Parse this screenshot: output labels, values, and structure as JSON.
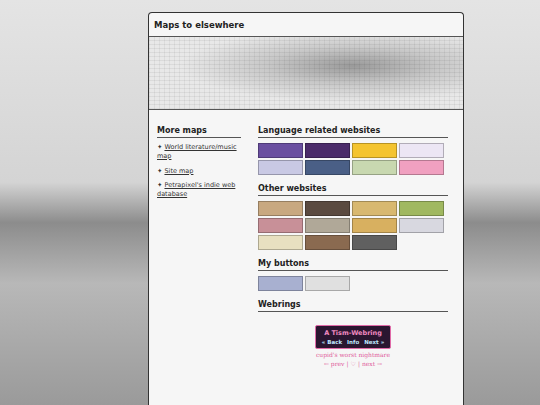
{
  "window": {
    "title": "Maps to elsewhere"
  },
  "sidebar": {
    "heading": "More maps",
    "items": [
      {
        "icon": "✦",
        "label": "World literature/music map"
      },
      {
        "icon": "✦",
        "label": "Site map"
      },
      {
        "icon": "✦",
        "label": "Petrapixel's indie web database"
      }
    ]
  },
  "sections": [
    {
      "heading": "Language related websites",
      "buttons": [
        {
          "color": "#6a4fa0"
        },
        {
          "color": "#4b2b6a"
        },
        {
          "color": "#f4c430"
        },
        {
          "color": "#ece6f4"
        },
        {
          "color": "#c9c9e4"
        },
        {
          "color": "#4a5f86"
        },
        {
          "color": "#c8d8b0"
        },
        {
          "color": "#f0a0c0"
        }
      ]
    },
    {
      "heading": "Other websites",
      "buttons": [
        {
          "color": "#c8a880"
        },
        {
          "color": "#5a4a40"
        },
        {
          "color": "#d8b870"
        },
        {
          "color": "#a0b860"
        },
        {
          "color": "#c89098"
        },
        {
          "color": "#b0a898"
        },
        {
          "color": "#d8b060"
        },
        {
          "color": "#d8d8e0"
        },
        {
          "color": "#e8e0c0"
        },
        {
          "color": "#8a6a50"
        },
        {
          "color": "#606060"
        }
      ]
    },
    {
      "heading": "My buttons",
      "buttons": [
        {
          "color": "#a8b0d0"
        },
        {
          "color": "#e0e0e0"
        }
      ]
    }
  ],
  "webrings": {
    "heading": "Webrings",
    "ring1": {
      "title": "A Tism-Webring",
      "links": [
        "« Back",
        "Info",
        "Next »"
      ]
    },
    "ring2": {
      "title": "cupid's worst nightmare",
      "prev": "← prev",
      "sep": "|",
      "heart": "♡",
      "next": "next →"
    }
  }
}
